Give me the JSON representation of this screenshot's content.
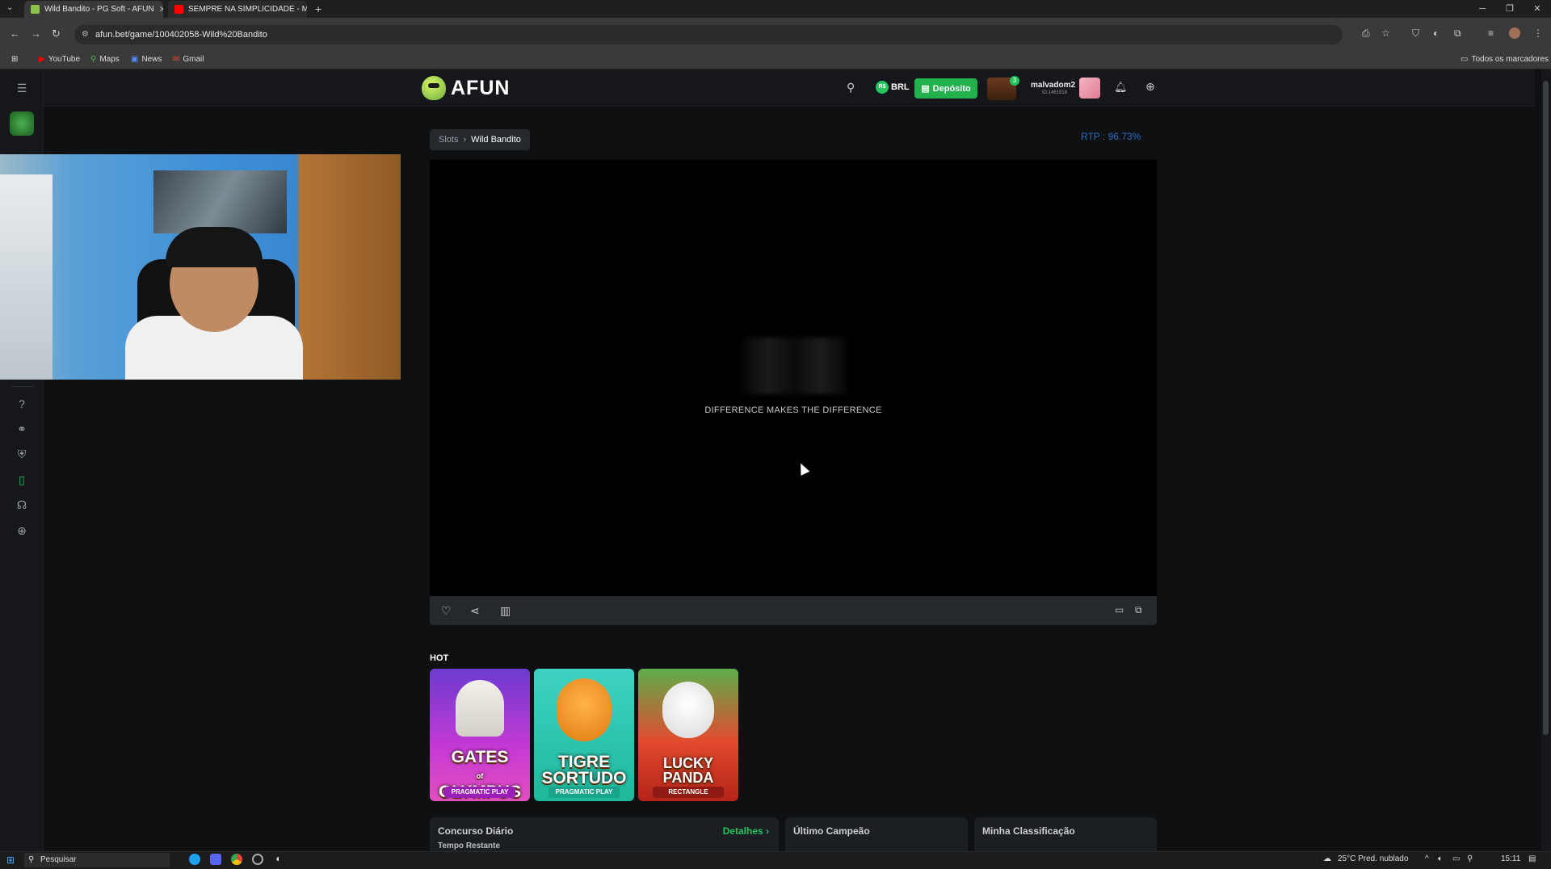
{
  "browser": {
    "tabs": [
      {
        "title": "Wild Bandito - PG Soft - AFUN",
        "favicon_color": "#8bc34a"
      },
      {
        "title": "SEMPRE NA SIMPLICIDADE - M",
        "favicon_color": "#ff0000"
      }
    ],
    "new_tab": "+",
    "window_controls": {
      "minimize": "─",
      "restore": "❐",
      "close": "✕"
    },
    "url": "afun.bet/game/100402058-Wild%20Bandito",
    "bookmarks": [
      "YouTube",
      "Maps",
      "News",
      "Gmail"
    ],
    "all_bookmarks": "Todos os marcadores"
  },
  "site": {
    "logo_text": "AFUN",
    "currency": "BRL",
    "currency_symbol": "R$",
    "deposit_label": "Depósito",
    "chest_badge": "3",
    "username": "malvadom2",
    "user_id": "ID:1461918"
  },
  "game": {
    "breadcrumb": {
      "parent": "Slots",
      "separator": "›",
      "current": "Wild Bandito"
    },
    "rtp": "RTP : 96.73%",
    "tagline": "DIFFERENCE MAKES THE DIFFERENCE"
  },
  "hot": {
    "title": "HOT",
    "games": [
      {
        "name_line1": "GATES",
        "name_sub": "of",
        "name_line2": "OLYMPUS",
        "provider": "PRAGMATIC PLAY",
        "bg": "#b62fd3",
        "provider_bg": "#9a1fb7"
      },
      {
        "name_line1": "TIGRE",
        "name_sub": "",
        "name_line2": "SORTUDO",
        "provider": "PRAGMATIC PLAY",
        "bg": "#23c8a8",
        "provider_bg": "#17a48a"
      },
      {
        "name_line1": "LUCKY",
        "name_sub": "",
        "name_line2": "PANDA",
        "provider": "RECTANGLE",
        "bg": "#d8402f",
        "provider_bg": "#8e1c14"
      }
    ]
  },
  "panels": {
    "daily": {
      "title": "Concurso Diário",
      "details": "Detalhes ›",
      "time_left": "Tempo Restante"
    },
    "last_champion": {
      "title": "Último Campeão"
    },
    "my_ranking": {
      "title": "Minha Classificação"
    }
  },
  "taskbar": {
    "search_placeholder": "Pesquisar",
    "weather": "25°C  Pred. nublado",
    "time": "15:11"
  }
}
